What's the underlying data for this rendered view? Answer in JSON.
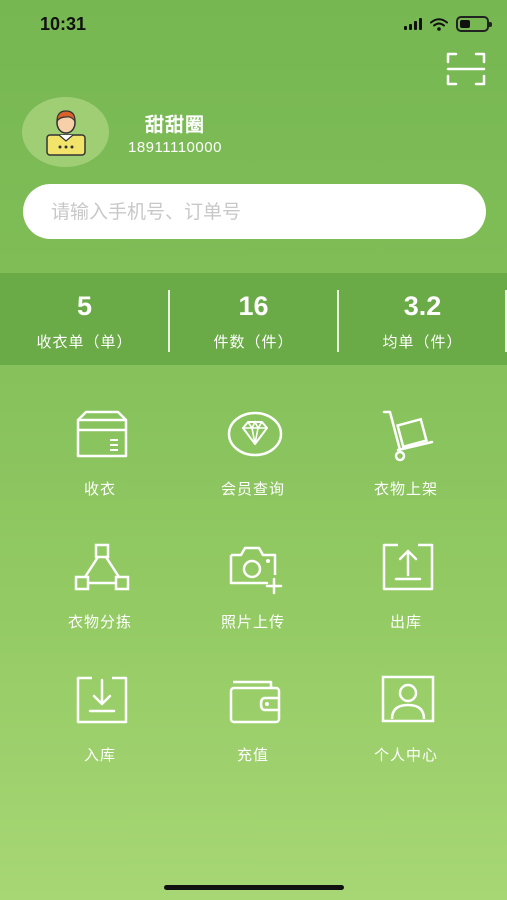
{
  "status_bar": {
    "time": "10:31",
    "battery_level": 0.4
  },
  "user": {
    "name": "甜甜圈",
    "phone": "18911110000",
    "avatar_icon": "user-avatar-icon"
  },
  "search": {
    "placeholder": "请输入手机号、订单号",
    "value": ""
  },
  "stats": [
    {
      "value": "5",
      "label": "收衣单（单）"
    },
    {
      "value": "16",
      "label": "件数（件）"
    },
    {
      "value": "3.2",
      "label": "均单（件）"
    }
  ],
  "menu": [
    {
      "label": "收衣",
      "icon": "box-icon"
    },
    {
      "label": "会员查询",
      "icon": "diamond-icon"
    },
    {
      "label": "衣物上架",
      "icon": "hand-truck-icon"
    },
    {
      "label": "衣物分拣",
      "icon": "hierarchy-icon"
    },
    {
      "label": "照片上传",
      "icon": "camera-add-icon"
    },
    {
      "label": "出库",
      "icon": "upload-box-icon"
    },
    {
      "label": "入库",
      "icon": "download-box-icon"
    },
    {
      "label": "充值",
      "icon": "wallet-icon"
    },
    {
      "label": "个人中心",
      "icon": "person-icon"
    }
  ],
  "colors": {
    "header_green": "#76b752",
    "stats_band": "#6aaa47",
    "bottom_green": "#a7d775",
    "avatar_bg": "#9fce75"
  }
}
